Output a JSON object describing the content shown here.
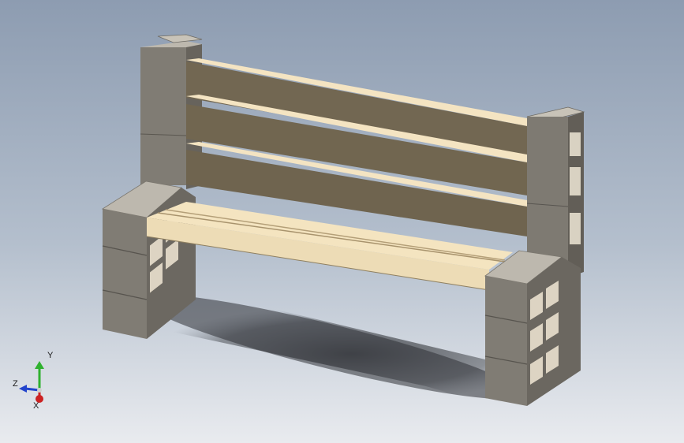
{
  "viewport": {
    "background_top": "#8d9cb1",
    "background_bottom": "#e9ebef"
  },
  "model": {
    "object": "bench",
    "plank_color": "#f3e3c0",
    "plank_shadow_color": "#716650",
    "block_color": "#7d7a73",
    "block_top_color": "#b9b4aa"
  },
  "triad": {
    "y_label": "Y",
    "z_label": "Z",
    "x_label": "X",
    "y_color": "#2fb12f",
    "z_color": "#2244cc",
    "x_color": "#cc2222"
  }
}
